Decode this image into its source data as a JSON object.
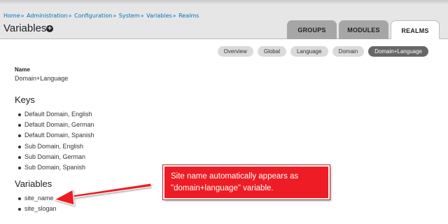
{
  "breadcrumb": {
    "items": [
      "Home",
      "Administration",
      "Configuration",
      "System",
      "Variables",
      "Realms"
    ],
    "separator": "»"
  },
  "page": {
    "title": "Variables",
    "add_icon_glyph": "+"
  },
  "tabs": [
    {
      "label": "GROUPS",
      "active": false
    },
    {
      "label": "MODULES",
      "active": false
    },
    {
      "label": "REALMS",
      "active": true
    }
  ],
  "realm_pills": [
    {
      "label": "Overview",
      "active": false
    },
    {
      "label": "Global",
      "active": false
    },
    {
      "label": "Language",
      "active": false
    },
    {
      "label": "Domain",
      "active": false
    },
    {
      "label": "Domain+Language",
      "active": true
    }
  ],
  "details": {
    "name_label": "Name",
    "name_value": "Domain+Language",
    "keys_heading": "Keys",
    "keys": [
      "Default Domain, English",
      "Default Domain, German",
      "Default Domain, Spanish",
      "Sub Domain, English",
      "Sub Domain, German",
      "Sub Domain, Spanish"
    ],
    "variables_heading": "Variables",
    "variables": [
      "site_name",
      "site_slogan"
    ]
  },
  "annotation": {
    "line1": "Site name automatically appears as",
    "line2": "\"domain+language\" variable.",
    "color": "#ee1c24",
    "arrow_icon": "red-arrow-icon"
  }
}
